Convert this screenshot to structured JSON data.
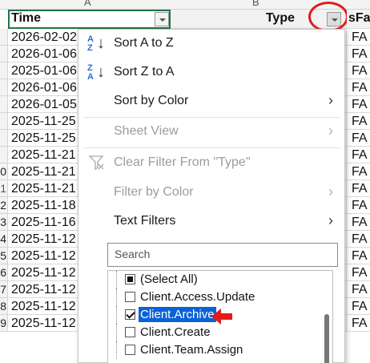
{
  "sheet": {
    "col_letters": [
      "A",
      "B"
    ],
    "header": {
      "time": "Time",
      "type": "Type",
      "third": "sFa"
    },
    "row_numbers": [
      "",
      "",
      "",
      "",
      "",
      "",
      "",
      "",
      "0",
      "1",
      "2",
      "3",
      "4",
      "5",
      "6",
      "7",
      "8",
      "9"
    ],
    "times": [
      "2026-02-02",
      "2026-01-06",
      "2025-01-06",
      "2026-01-06",
      "2026-01-05",
      "2025-11-25",
      "2025-11-25",
      "2025-11-21",
      "2025-11-21",
      "2025-11-21",
      "2025-11-18",
      "2025-11-16",
      "2025-11-12",
      "2025-11-12",
      "2025-11-12",
      "2025-11-12",
      "2025-11-12",
      "2025-11-12"
    ],
    "third_values": [
      "FA",
      "FA",
      "FA",
      "FA",
      "FA",
      "FA",
      "FA",
      "FA",
      "FA",
      "FA",
      "FA",
      "FA",
      "FA",
      "FA",
      "FA",
      "FA",
      "FA",
      "FA"
    ]
  },
  "menu": {
    "sort_az": "Sort A to Z",
    "sort_za": "Sort Z to A",
    "sort_by_color": "Sort by Color",
    "sheet_view": "Sheet View",
    "clear_filter": "Clear Filter From \"Type\"",
    "filter_by_color": "Filter by Color",
    "text_filters": "Text Filters",
    "search_placeholder": "Search",
    "list": [
      {
        "label": "(Select All)",
        "state": "partial"
      },
      {
        "label": "Client.Access.Update",
        "state": "unchecked"
      },
      {
        "label": "Client.Archive",
        "state": "checked"
      },
      {
        "label": "Client.Create",
        "state": "unchecked"
      },
      {
        "label": "Client.Team.Assign",
        "state": "unchecked"
      }
    ]
  },
  "colors": {
    "highlight": "#0b62d6",
    "annotation": "#e21b1b",
    "sheet_accent": "#217346"
  },
  "icons": {
    "sort_az": "sort-ascending-icon",
    "sort_za": "sort-descending-icon",
    "clear_filter": "funnel-clear-icon",
    "submenu": "chevron-right-icon"
  }
}
